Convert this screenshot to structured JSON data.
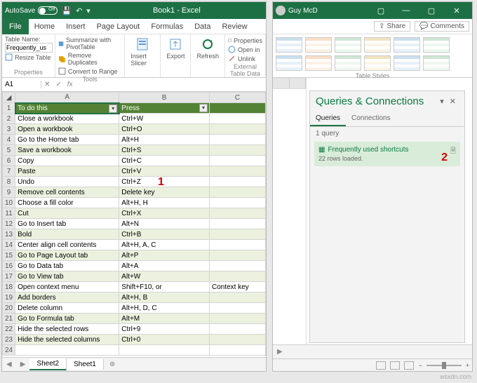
{
  "left": {
    "titlebar": {
      "autosave_label": "AutoSave",
      "autosave_state": "Off",
      "title": "Book1 - Excel"
    },
    "menu": {
      "file": "File",
      "tabs": [
        "Home",
        "Insert",
        "Page Layout",
        "Formulas",
        "Data",
        "Review"
      ]
    },
    "ribbon": {
      "properties": {
        "label": "Properties",
        "tablename_label": "Table Name:",
        "tablename_value": "Frequently_us",
        "resize": "Resize Table"
      },
      "tools": {
        "label": "Tools",
        "summarize": "Summarize with PivotTable",
        "remove_dupes": "Remove Duplicates",
        "convert": "Convert to Range"
      },
      "slicer": {
        "label": "Insert Slicer"
      },
      "export": {
        "label": "Export"
      },
      "refresh": {
        "label": "Refresh"
      },
      "external": {
        "label": "External Table Data",
        "properties": "Properties",
        "openin": "Open in",
        "unlink": "Unlink"
      }
    },
    "formula": {
      "namebox": "A1",
      "value": ""
    },
    "columns": [
      "A",
      "B",
      "C"
    ],
    "headers": [
      "To do this",
      "Press",
      ""
    ],
    "rows": [
      {
        "n": 2,
        "a": "Close a workbook",
        "b": "Ctrl+W"
      },
      {
        "n": 3,
        "a": "Open a workbook",
        "b": "Ctrl+O"
      },
      {
        "n": 4,
        "a": "Go to the Home tab",
        "b": "Alt+H"
      },
      {
        "n": 5,
        "a": "Save a workbook",
        "b": "Ctrl+S"
      },
      {
        "n": 6,
        "a": "Copy",
        "b": "Ctrl+C"
      },
      {
        "n": 7,
        "a": "Paste",
        "b": "Ctrl+V"
      },
      {
        "n": 8,
        "a": "Undo",
        "b": "Ctrl+Z"
      },
      {
        "n": 9,
        "a": "Remove cell contents",
        "b": "Delete key"
      },
      {
        "n": 10,
        "a": "Choose a fill color",
        "b": "Alt+H, H"
      },
      {
        "n": 11,
        "a": "Cut",
        "b": "Ctrl+X"
      },
      {
        "n": 12,
        "a": "Go to Insert tab",
        "b": "Alt+N"
      },
      {
        "n": 13,
        "a": "Bold",
        "b": "Ctrl+B"
      },
      {
        "n": 14,
        "a": "Center align cell contents",
        "b": "Alt+H, A, C"
      },
      {
        "n": 15,
        "a": "Go to Page Layout tab",
        "b": "Alt+P"
      },
      {
        "n": 16,
        "a": "Go to Data tab",
        "b": "Alt+A"
      },
      {
        "n": 17,
        "a": "Go to View tab",
        "b": "Alt+W"
      },
      {
        "n": 18,
        "a": "Open context menu",
        "b": "Shift+F10, or",
        "c": "Context key"
      },
      {
        "n": 19,
        "a": "Add borders",
        "b": "Alt+H, B"
      },
      {
        "n": 20,
        "a": "Delete column",
        "b": "Alt+H, D, C"
      },
      {
        "n": 21,
        "a": "Go to Formula tab",
        "b": "Alt+M"
      },
      {
        "n": 22,
        "a": "Hide the selected rows",
        "b": "Ctrl+9"
      },
      {
        "n": 23,
        "a": "Hide the selected columns",
        "b": "Ctrl+0"
      },
      {
        "n": 24,
        "a": "",
        "b": ""
      }
    ],
    "annot_1": "1",
    "sheets": {
      "active": "Sheet2",
      "other": "Sheet1"
    }
  },
  "right": {
    "titlebar": {
      "user": "Guy McD"
    },
    "menu": {
      "share": "Share",
      "comments": "Comments"
    },
    "tablestyles_label": "Table Styles",
    "panel": {
      "title": "Queries & Connections",
      "tabs": {
        "queries": "Queries",
        "connections": "Connections"
      },
      "count": "1 query",
      "item": {
        "title": "Frequently used shortcuts",
        "sub": "22 rows loaded."
      },
      "annot_2": "2"
    }
  },
  "watermark": "wsxdn.com"
}
